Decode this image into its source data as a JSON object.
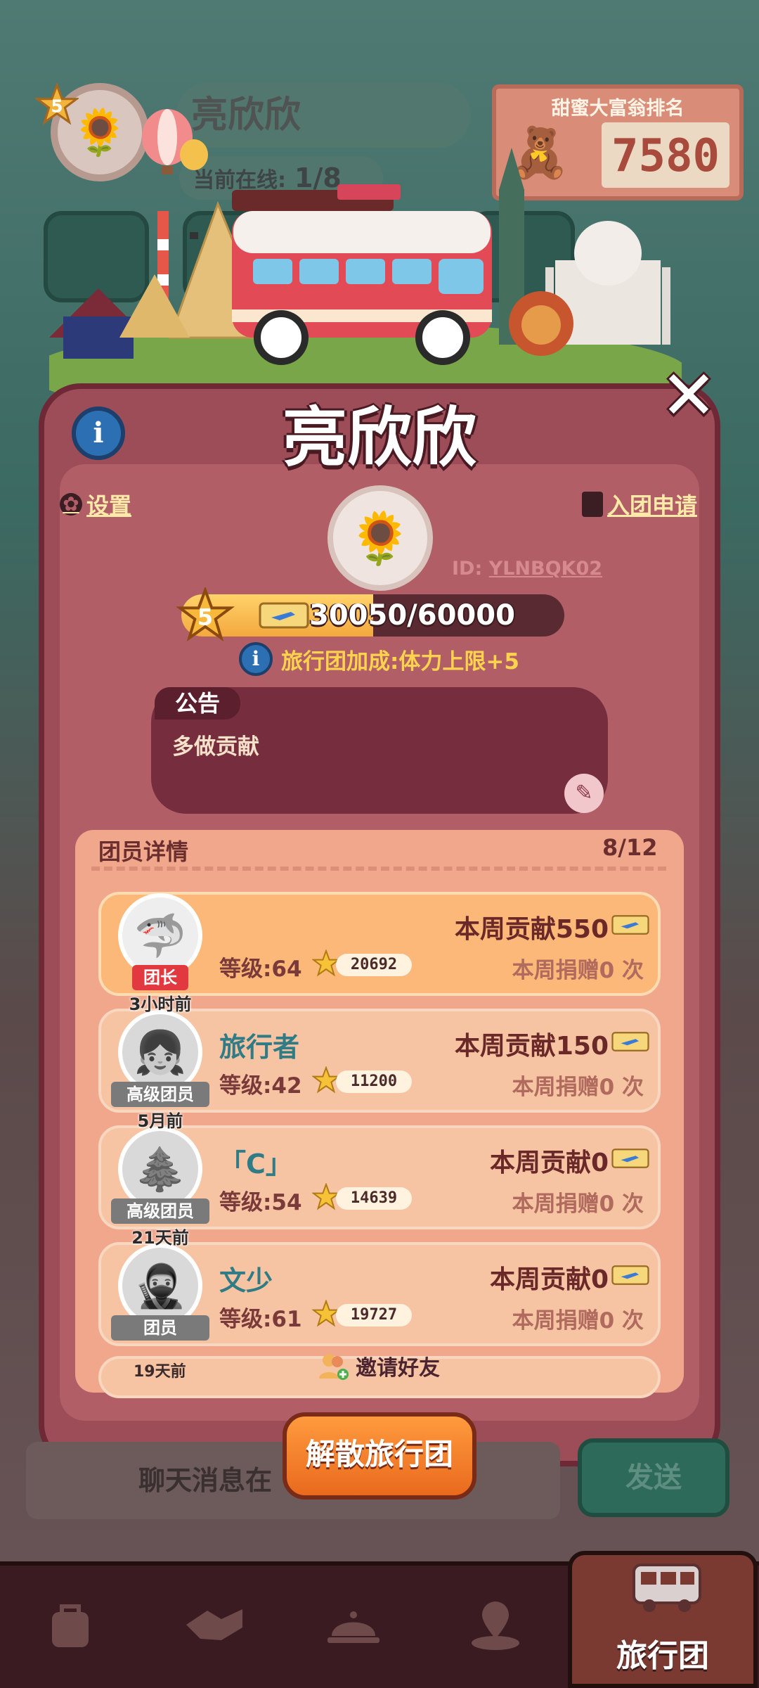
{
  "background": {
    "profile_name": "亮欣欣",
    "online_label": "当前在线:",
    "online_value": "1/8",
    "profile_level": "5",
    "ranking_title": "甜蜜大富翁排名",
    "ranking_value": "7580",
    "chat_placeholder": "聊天消息在",
    "send_label": "发送"
  },
  "modal": {
    "title": "亮欣欣",
    "settings_label": "设置",
    "apply_label": "入团申请",
    "group_id_label": "ID:",
    "group_id_value": "YLNBQK02",
    "level": "5",
    "exp_text": "30050/60000",
    "exp_fraction": 0.50083,
    "bonus_text": "旅行团加成:体力上限+5",
    "announcement_title": "公告",
    "announcement_text": "多做贡献",
    "members_title": "团员详情",
    "members_count": "8/12",
    "invite_label": "邀请好友",
    "disband_label": "解散旅行团"
  },
  "members": [
    {
      "name": "",
      "role": "团长",
      "last_seen": "",
      "level": "等级:64",
      "stars": "20692",
      "contribution": "本周贡献550",
      "donation": "本周捐赠0 次"
    },
    {
      "name": "旅行者",
      "role": "高级团员",
      "last_seen": "3小时前",
      "level": "等级:42",
      "stars": "11200",
      "contribution": "本周贡献150",
      "donation": "本周捐赠0 次"
    },
    {
      "name": "「C」",
      "role": "高级团员",
      "last_seen": "5月前",
      "level": "等级:54",
      "stars": "14639",
      "contribution": "本周贡献0",
      "donation": "本周捐赠0 次"
    },
    {
      "name": "文少",
      "role": "团员",
      "last_seen": "21天前",
      "level": "等级:61",
      "stars": "19727",
      "contribution": "本周贡献0",
      "donation": "本周捐赠0 次"
    }
  ],
  "peek_last_seen": "19天前",
  "bottom_nav": {
    "active_label": "旅行团",
    "items": [
      "backpack-icon",
      "handshake-icon",
      "service-bell-icon",
      "map-pin-icon",
      "bus-icon"
    ]
  },
  "colors": {
    "modal": "#9c4d58",
    "accent_orange": "#e96a1d",
    "exp_fill": "#f3a83e",
    "name_teal": "#2f7b86"
  }
}
